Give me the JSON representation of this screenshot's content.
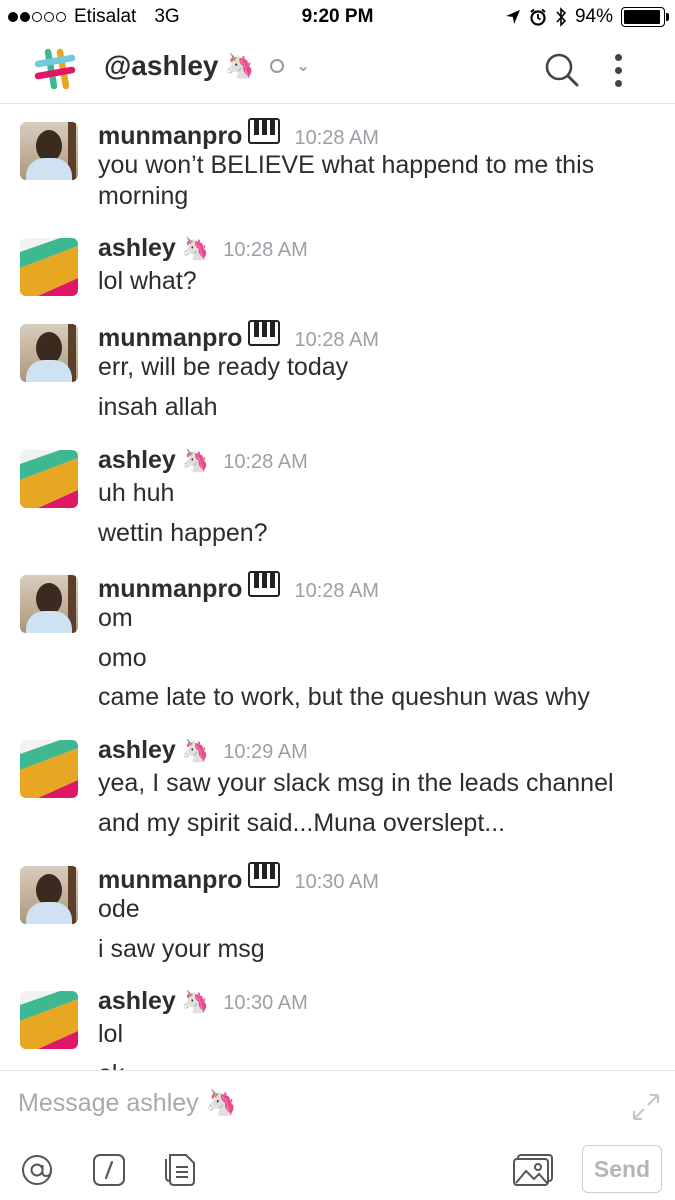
{
  "status_bar": {
    "carrier": "Etisalat",
    "network": "3G",
    "time": "9:20 PM",
    "battery": "94%",
    "battery_level": 0.94,
    "signal_bars_filled": 2,
    "signal_bars_total": 5
  },
  "header": {
    "title": "@ashley",
    "title_emoji": "🦄",
    "icons": [
      "slack-logo",
      "presence-status",
      "chevron-down",
      "search-icon",
      "more-vertical-icon"
    ]
  },
  "messages": [
    {
      "sender": "munmanpro",
      "badge": "piano",
      "time": "10:28 AM",
      "lines": [
        "you won’t BELIEVE what happend to me this morning"
      ]
    },
    {
      "sender": "ashley",
      "badge": "🦄",
      "time": "10:28 AM",
      "lines": [
        "lol what?"
      ]
    },
    {
      "sender": "munmanpro",
      "badge": "piano",
      "time": "10:28 AM",
      "lines": [
        "err, will be ready today",
        "insah allah"
      ]
    },
    {
      "sender": "ashley",
      "badge": "🦄",
      "time": "10:28 AM",
      "lines": [
        "uh huh",
        "wettin happen?"
      ]
    },
    {
      "sender": "munmanpro",
      "badge": "piano",
      "time": "10:28 AM",
      "lines": [
        "om",
        "omo",
        "came late to work, but the queshun was why"
      ]
    },
    {
      "sender": "ashley",
      "badge": "🦄",
      "time": "10:29 AM",
      "lines": [
        "yea, I saw your slack msg in the leads channel",
        "and my spirit said...Muna overslept..."
      ]
    },
    {
      "sender": "munmanpro",
      "badge": "piano",
      "time": "10:30 AM",
      "lines": [
        "ode",
        "i saw your msg"
      ]
    },
    {
      "sender": "ashley",
      "badge": "🦄",
      "time": "10:30 AM",
      "lines": [
        "lol",
        "ok"
      ]
    }
  ],
  "composer": {
    "placeholder": "Message ashley 🦄",
    "send_label": "Send",
    "icons": [
      "at-icon",
      "slash-command-icon",
      "file-icon",
      "photo-icon",
      "expand-icon"
    ]
  },
  "colors": {
    "text": "#2c2d30",
    "timestamp": "#9e9ea6",
    "placeholder": "#a8a8ad",
    "slack_yellow": "#e8a723",
    "slack_green": "#3eb890",
    "slack_red": "#e01765",
    "slack_blue": "#6ecadc"
  }
}
